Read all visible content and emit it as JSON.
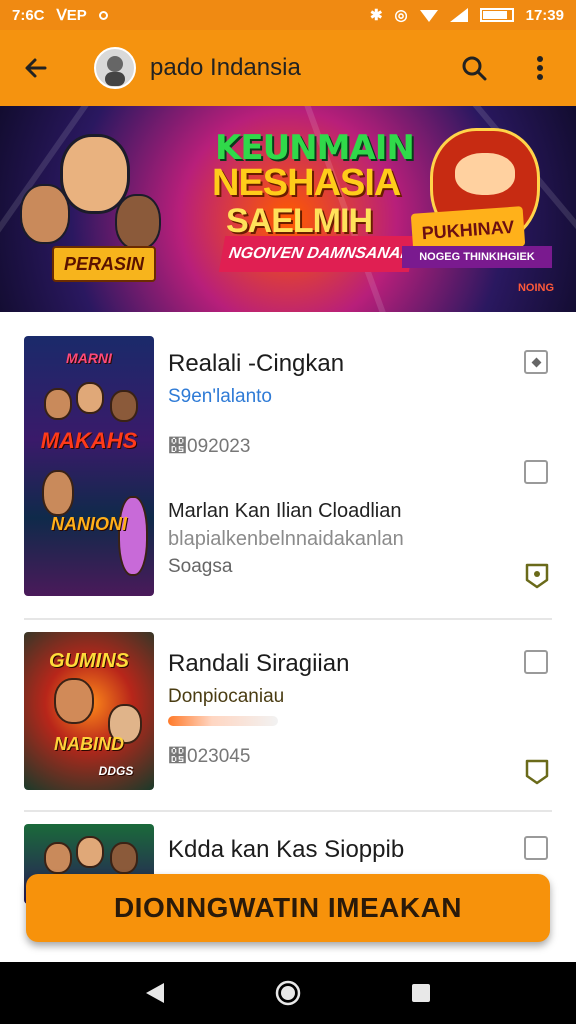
{
  "status_bar": {
    "time": "7:6C",
    "carrier": "ᐯEP",
    "clock": "17:39"
  },
  "app_bar": {
    "title": "pado Indansia"
  },
  "banner": {
    "line1": "KEUNMAIN",
    "line2": "NESHASIA",
    "line3": "SAELMIH",
    "ribbon": "NGOIVEN DAMNSANAI",
    "tag": "PUKHINAV",
    "tagsub": "NOGEG THINKIHGIEK",
    "left_badge": "PERASIN",
    "corner": "NOING"
  },
  "items": [
    {
      "title": "Realali -Cingkan",
      "subtitle": "S9en'lalanto",
      "number": "෕092023",
      "description": "Marlan Kan Ilian Cloadlian",
      "description2": "blapialkenbelnnaidakanlan",
      "footer": "Soagsa",
      "thumb_top": "MARNI",
      "thumb_mid": "MAKAHS",
      "thumb_bottom": "NANIONI"
    },
    {
      "title": "Randali Siragiian",
      "subtitle": "Donpiocaniau",
      "number": "෕023045",
      "thumb_top": "GUMINS",
      "thumb_mid": "NABIND",
      "thumb_bottom": "DDGS"
    },
    {
      "title": "Kdda kan Kas Sioppib"
    }
  ],
  "cta": {
    "label": "DIONNGWATIN IMEAKAN"
  },
  "colors": {
    "accent": "#f5930f",
    "link": "#2f7bd6"
  }
}
